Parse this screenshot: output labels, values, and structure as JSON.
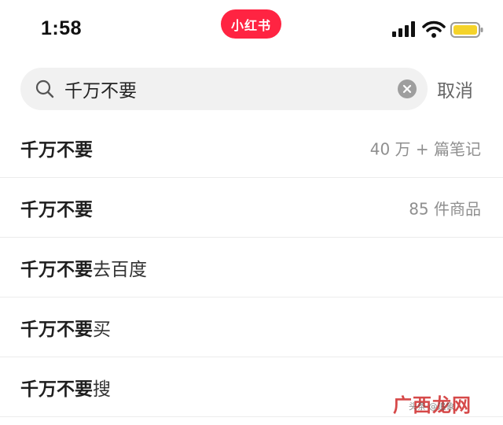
{
  "status_bar": {
    "time": "1:58",
    "app_logo_text": "小红书",
    "icons": [
      "signal-icon",
      "wifi-icon",
      "battery-icon"
    ],
    "battery_color": "#f5d32a"
  },
  "search": {
    "query": "千万不要",
    "cancel_label": "取消"
  },
  "suggestions": [
    {
      "term": "千万不要",
      "suffix": "",
      "meta": "40 万 + 篇笔记"
    },
    {
      "term": "千万不要",
      "suffix": "",
      "meta": "85 件商品"
    },
    {
      "term": "千万不要",
      "suffix": "去百度",
      "meta": ""
    },
    {
      "term": "千万不要",
      "suffix": "买",
      "meta": ""
    },
    {
      "term": "千万不要",
      "suffix": "搜",
      "meta": ""
    }
  ],
  "watermark": {
    "main": "广西龙网",
    "sub": "头条 @追象"
  },
  "colors": {
    "brand": "#ff2442",
    "search_bg": "#f1f1f1",
    "meta_text": "#8f8f8f"
  }
}
